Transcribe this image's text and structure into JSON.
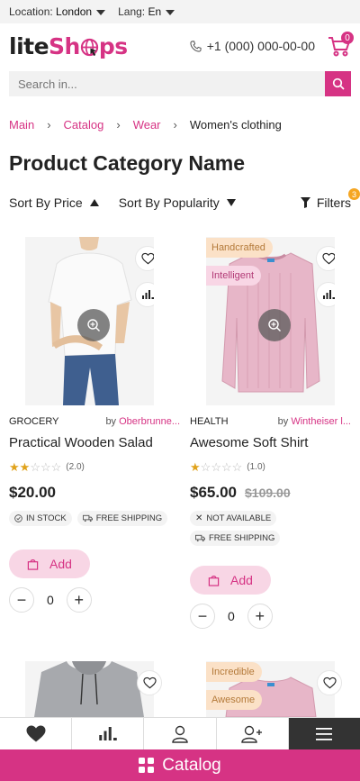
{
  "topbar": {
    "location_label": "Location:",
    "location_value": "London",
    "lang_label": "Lang:",
    "lang_value": "En"
  },
  "header": {
    "logo_part1": "lite",
    "logo_part2": "Sh",
    "logo_part3": "ps",
    "phone": "+1 (000) 000-00-00",
    "cart_count": "0"
  },
  "search": {
    "placeholder": "Search in..."
  },
  "breadcrumb": [
    "Main",
    "Catalog",
    "Wear",
    "Women's clothing"
  ],
  "page_title": "Product Category Name",
  "sort": {
    "price_label": "Sort By Price",
    "popularity_label": "Sort By Popularity",
    "filters_label": "Filters",
    "filters_count": "3"
  },
  "products": [
    {
      "category": "GROCERY",
      "by": "by",
      "brand": "Oberbrunne...",
      "name": "Practical Wooden Salad",
      "rating": 2,
      "rating_text": "(2.0)",
      "price": "$20.00",
      "old_price": "",
      "tags": [],
      "chips": [
        "IN STOCK",
        "FREE SHIPPING"
      ],
      "add_label": "Add",
      "qty": "0"
    },
    {
      "category": "HEALTH",
      "by": "by",
      "brand": "Wintheiser l...",
      "name": "Awesome Soft Shirt",
      "rating": 1,
      "rating_text": "(1.0)",
      "price": "$65.00",
      "old_price": "$109.00",
      "tags": [
        "Handcrafted",
        "Intelligent"
      ],
      "chips": [
        "NOT AVAILABLE",
        "FREE SHIPPING"
      ],
      "add_label": "Add",
      "qty": "0"
    },
    {
      "tags": []
    },
    {
      "tags": [
        "Incredible",
        "Awesome"
      ]
    }
  ],
  "bottom_bar": {
    "catalog_label": "Catalog"
  },
  "colors": {
    "accent": "#d63384",
    "tag_orange": "#fbe1c7",
    "tag_pink": "#f8d6e5"
  }
}
